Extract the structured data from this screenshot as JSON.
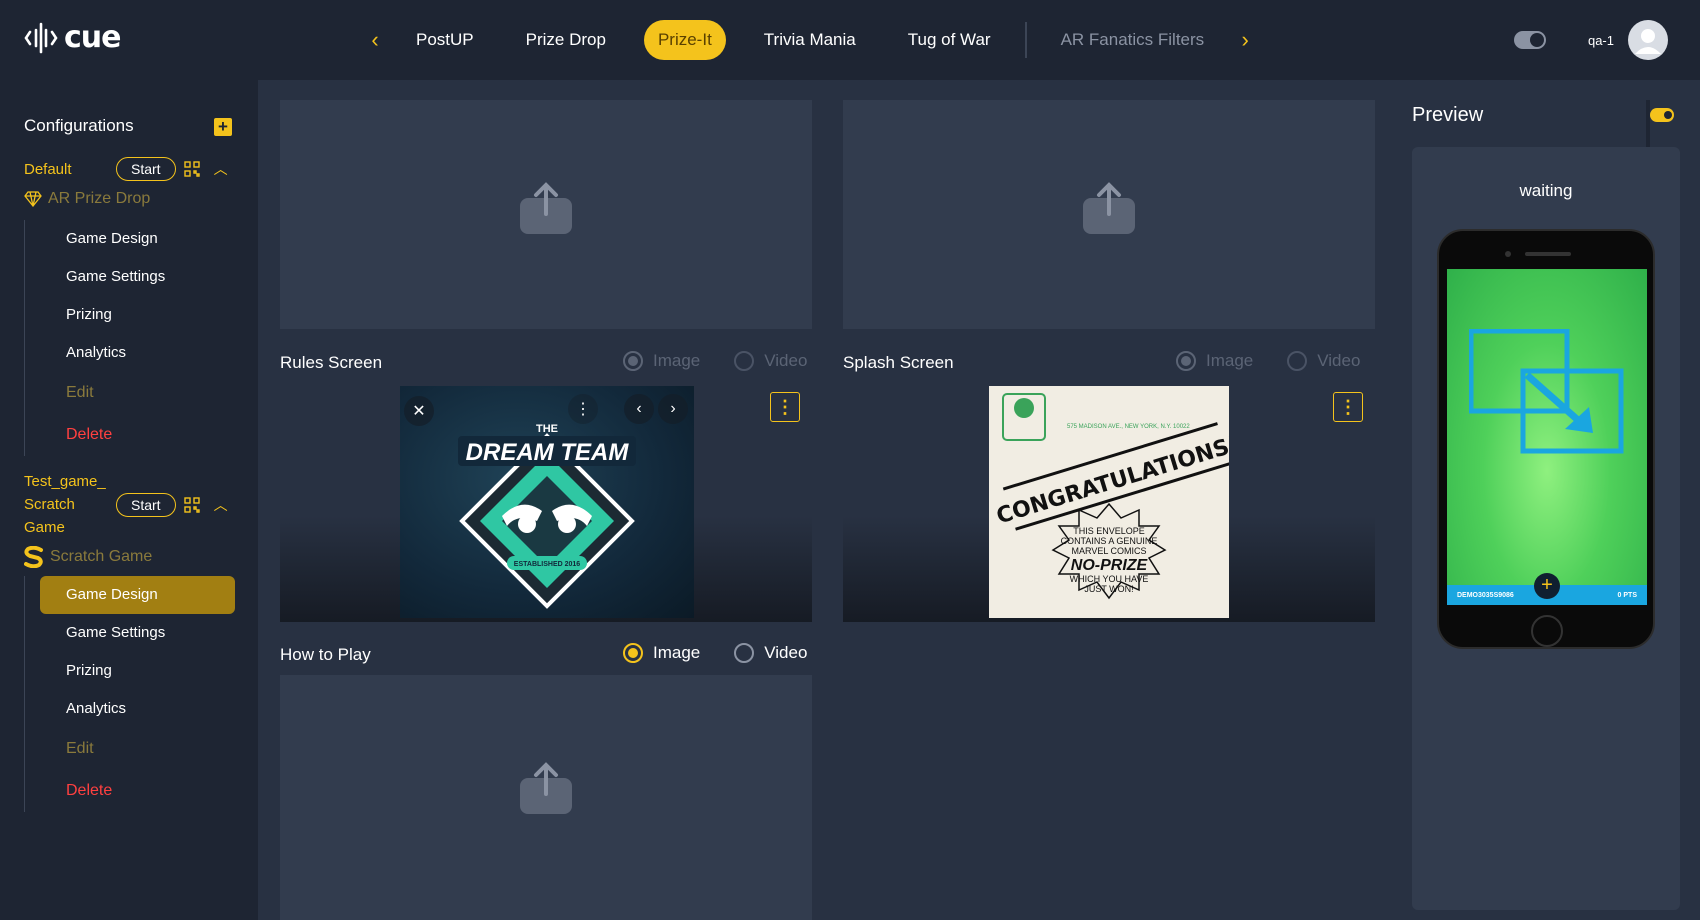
{
  "app": {
    "logo": "cue"
  },
  "nav": {
    "tabs": [
      {
        "label": "PostUP",
        "state": "normal"
      },
      {
        "label": "Prize Drop",
        "state": "normal"
      },
      {
        "label": "Prize-It",
        "state": "active"
      },
      {
        "label": "Trivia Mania",
        "state": "normal"
      },
      {
        "label": "Tug of War",
        "state": "normal"
      },
      {
        "label": "AR Fanatics Filters",
        "state": "dim"
      }
    ]
  },
  "user": {
    "name": "qa-1"
  },
  "sidebar": {
    "heading": "Configurations",
    "games": [
      {
        "name": "Default",
        "start_label": "Start",
        "type": "AR Prize Drop",
        "items": [
          "Game Design",
          "Game Settings",
          "Prizing",
          "Analytics"
        ],
        "edit": "Edit",
        "delete": "Delete"
      },
      {
        "name": "Test_game_ Scratch Game",
        "name_lines": [
          "Test_game_",
          "Scratch",
          "Game"
        ],
        "start_label": "Start",
        "type": "Scratch Game",
        "items": [
          "Game Design",
          "Game Settings",
          "Prizing",
          "Analytics"
        ],
        "active_item": "Game Design",
        "edit": "Edit",
        "delete": "Delete"
      }
    ]
  },
  "sections": {
    "rules": {
      "label": "Rules Screen",
      "image": "Image",
      "video": "Video",
      "selected": "Image",
      "enabled": false
    },
    "splash": {
      "label": "Splash Screen",
      "image": "Image",
      "video": "Video",
      "selected": "Image",
      "enabled": false
    },
    "how_to_play": {
      "label": "How to Play",
      "image": "Image",
      "video": "Video",
      "selected": "Image",
      "enabled": true
    }
  },
  "media": {
    "rules_image": {
      "line1": "THE",
      "line2": "DREAM TEAM",
      "line3": "ESTABLISHED 2016"
    },
    "splash_image": {
      "address": "575 MADISON AVE., NEW YORK, N.Y. 10022",
      "headline": "CONGRATULATIONS!",
      "line1": "THIS ENVELOPE",
      "line2": "CONTAINS A GENUINE",
      "line3": "MARVEL COMICS",
      "line4": "NO-PRIZE",
      "line5": "WHICH YOU HAVE",
      "line6": "JUST WON!"
    }
  },
  "preview": {
    "title": "Preview",
    "status": "waiting",
    "bar_left": "DEMO3035S9086",
    "bar_right": "0 PTS"
  },
  "colors": {
    "accent": "#f4c31c",
    "danger": "#ff4040",
    "panel": "#323c4e",
    "bg": "#1e2533"
  }
}
